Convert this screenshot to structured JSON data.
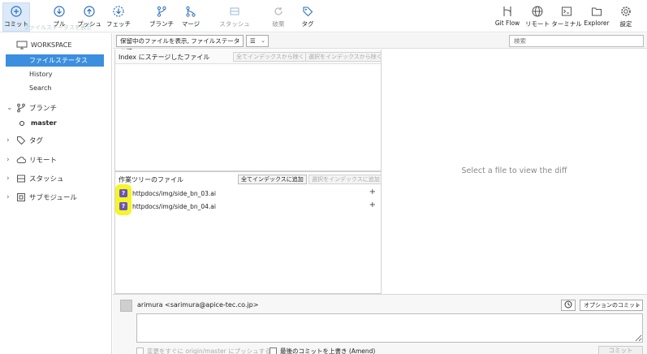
{
  "toolbar": {
    "commit": "コミット",
    "pull": "プル",
    "push": "プッシュ",
    "fetch": "フェッチ",
    "branch": "ブランチ",
    "merge": "マージ",
    "stash": "スタッシュ",
    "discard": "破棄",
    "tag": "タグ",
    "gitflow": "Git Flow",
    "remote": "リモート",
    "terminal": "ターミナル",
    "explorer": "Explorer",
    "settings": "設定",
    "ghost_tooltip": "ファイルステータスを表示"
  },
  "sidebar": {
    "workspace": "WORKSPACE",
    "items": [
      {
        "label": "ファイルステータス",
        "selected": true
      },
      {
        "label": "History"
      },
      {
        "label": "Search"
      }
    ],
    "sections": {
      "branches": "ブランチ",
      "current_branch": "master",
      "tags": "タグ",
      "remotes": "リモート",
      "stashes": "スタッシュ",
      "submodules": "サブモジュール"
    }
  },
  "filter": {
    "status_filter": "保留中のファイルを表示, ファイルステータス順",
    "view_mode_icon": "list-icon",
    "search_placeholder": "検索"
  },
  "staged": {
    "title": "Index にステージしたファイル",
    "unstage_all": "全てインデックスから除く",
    "unstage_selected": "選択をインデックスから除く"
  },
  "working": {
    "title": "作業ツリーのファイル",
    "stage_all": "全てインデックスに追加",
    "stage_selected": "選択をインデックスに追加",
    "files": [
      {
        "path": "httpdocs/img/side_bn_03.ai",
        "status": "?"
      },
      {
        "path": "httpdocs/img/side_bn_04.ai",
        "status": "?"
      }
    ],
    "highlight_color": "#f4f41c"
  },
  "diff": {
    "placeholder": "Select a file to view the diff"
  },
  "commit": {
    "author": "arimura <sarimura@apice-tec.co.jp>",
    "options": "オプションのコミット",
    "push_immediately": "変更をすぐに origin/master にプッシュする",
    "amend": "最後のコミットを上書き (Amend)",
    "submit": "コミット"
  },
  "colors": {
    "selection": "#3c8fde",
    "status_untracked": "#6a55b8",
    "icon_blue": "#2d6fc2"
  }
}
